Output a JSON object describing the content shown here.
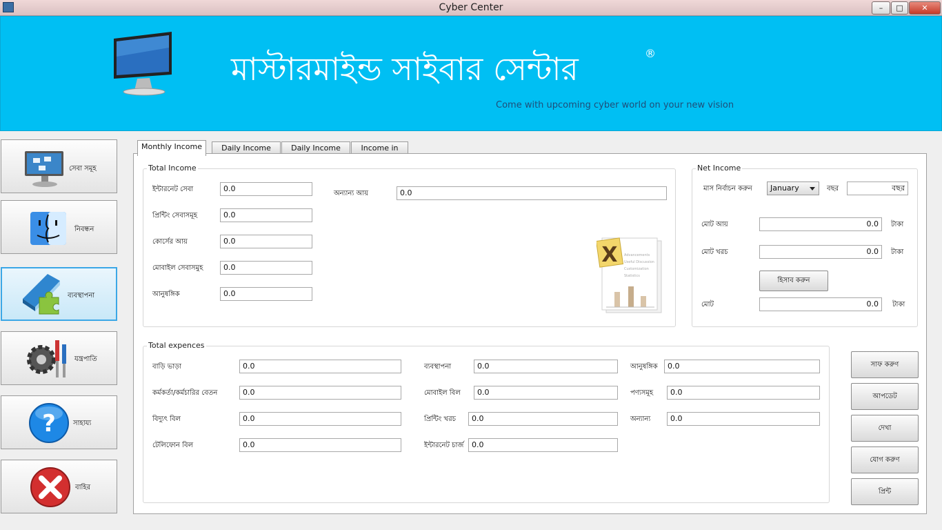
{
  "window": {
    "title": "Cyber Center",
    "minimize": "–",
    "maximize": "□",
    "close": "✕"
  },
  "banner": {
    "title": "মাস্টারমাইন্ড সাইবার সেন্টার",
    "registered": "®",
    "slogan": "Come with upcoming cyber world on your new vision"
  },
  "sidebar": {
    "items": [
      {
        "label": "সেবা সমূহ",
        "icon": "services-monitor-icon"
      },
      {
        "label": "নিবন্ধন",
        "icon": "registration-face-icon"
      },
      {
        "label": "ব্যবস্থাপনা",
        "icon": "management-puzzle-icon"
      },
      {
        "label": "যন্ত্রপাতি",
        "icon": "tools-gear-icon"
      },
      {
        "label": "সাহায্য",
        "icon": "help-question-icon"
      },
      {
        "label": "বাহির",
        "icon": "exit-x-icon"
      }
    ]
  },
  "tabs": [
    "Monthly Income",
    "Daily Income",
    "Daily Income chart",
    "Income in Table"
  ],
  "total_income": {
    "legend": "Total Income",
    "fields": [
      {
        "label": "ইন্টারনেট সেবা",
        "value": "0.0"
      },
      {
        "label": "প্রিন্টিং সেবাসমূহ",
        "value": "0.0"
      },
      {
        "label": "কোর্সের আয়",
        "value": "0.0"
      },
      {
        "label": "মোবাইল সেবাসমুহ",
        "value": "0.0"
      },
      {
        "label": "আনুষঙ্গিক",
        "value": "0.0"
      }
    ],
    "other": {
      "label": "অন্যান্য আয়",
      "value": "0.0"
    }
  },
  "net_income": {
    "legend": "Net Income",
    "month_label": "মাস নির্বাচন করুন",
    "month_value": "January",
    "year_label": "বছর",
    "year_value": "বছর",
    "total_income_label": "মোট আয়",
    "total_income_value": "0.0",
    "total_expense_label": "মোট খরচ",
    "total_expense_value": "0.0",
    "calc_button": "হিসাব করুন",
    "total_label": "মোট",
    "total_value": "0.0",
    "currency": "টাকা"
  },
  "total_expences": {
    "legend": "Total expences",
    "col1": [
      {
        "label": "বাড়ি ভাড়া",
        "value": "0.0"
      },
      {
        "label": "কর্মকর্তা/কর্মচারির বেতন",
        "value": "0.0"
      },
      {
        "label": "বিদ্যুৎ বিল",
        "value": "0.0"
      },
      {
        "label": "টেলিফোন বিল",
        "value": "0.0"
      }
    ],
    "col2": [
      {
        "label": "ব্যবস্থাপনা",
        "value": "0.0"
      },
      {
        "label": "মোবাইল বিল",
        "value": "0.0"
      },
      {
        "label": "প্রিন্টিং খরচ",
        "value": "0.0"
      },
      {
        "label": "ইন্টারনেট চার্জ",
        "value": "0.0"
      }
    ],
    "col3": [
      {
        "label": "আনুষঙ্গিক",
        "value": "0.0"
      },
      {
        "label": "পণ্যসমূহ",
        "value": "0.0"
      },
      {
        "label": "অন্যান্য",
        "value": "0.0"
      }
    ]
  },
  "actions": [
    "সাফ করুণ",
    "আপডেট",
    "দেখা",
    "যোগ করুণ",
    "প্রিন্ট"
  ],
  "xdoc": {
    "letter": "X",
    "lines": [
      "Advancements",
      "Useful Discussion",
      "Customization",
      "Statistics"
    ]
  }
}
